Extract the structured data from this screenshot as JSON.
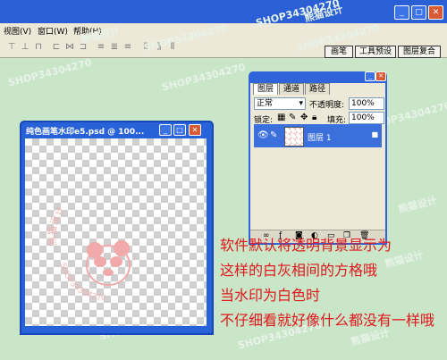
{
  "menu": [
    "视图(V)",
    "窗口(W)",
    "帮助(H)"
  ],
  "palette_wells": [
    "画笔",
    "工具预设",
    "图层复合"
  ],
  "doc_window": {
    "title": "纯色画笔水印e5.psd @ 100...",
    "stamp_text": [
      "熊猫设计",
      "SHOP34304270"
    ]
  },
  "layers_panel": {
    "tabs": [
      "图层",
      "通道",
      "路径"
    ],
    "blend_mode": "正常",
    "opacity_label": "不透明度:",
    "opacity_value": "100%",
    "lock_label": "锁定:",
    "fill_label": "填充:",
    "fill_value": "100%",
    "layer_name": "图层 1"
  },
  "annotation": [
    "软件默认将透明背景显示为",
    "这样的白灰相间的方格哦",
    "当水印为白色时",
    "不仔细看就好像什么都没有一样哦"
  ],
  "watermarks": [
    "SHOP34304270",
    "熊猫设计"
  ],
  "colors": {
    "annotation": "#e0161a",
    "titlebar": "#2a5fd6",
    "workspace": "#c9e6c9"
  }
}
